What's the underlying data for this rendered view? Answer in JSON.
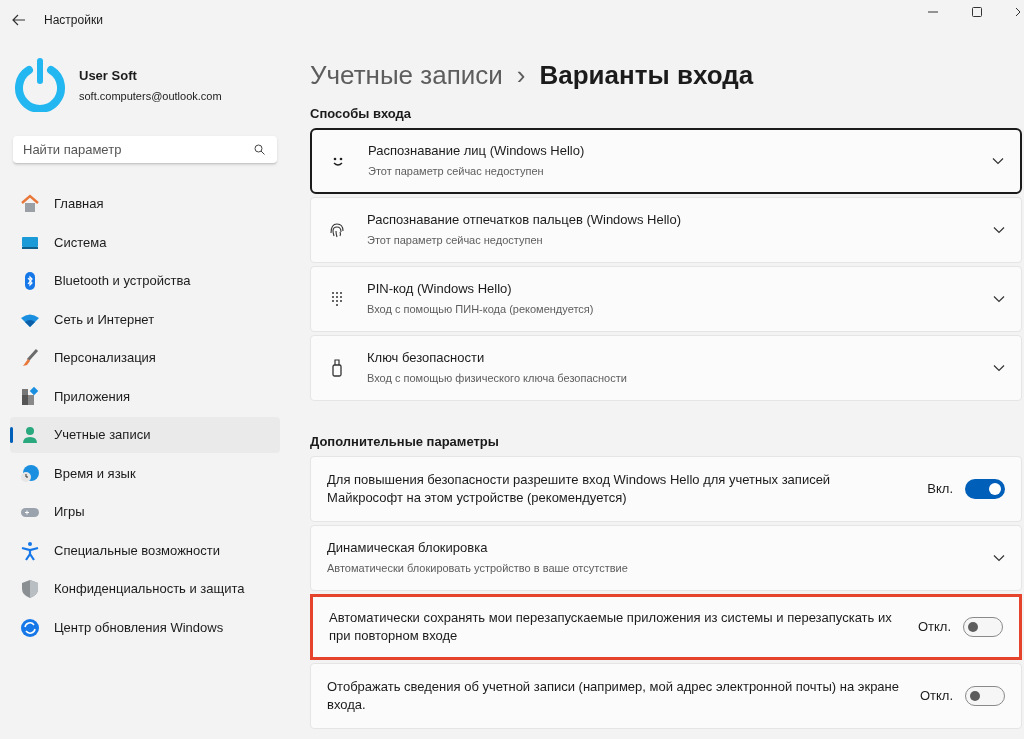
{
  "window": {
    "title": "Настройки"
  },
  "user": {
    "name": "User Soft",
    "email": "soft.computers@outlook.com"
  },
  "search": {
    "placeholder": "Найти параметр"
  },
  "sidebar": {
    "items": [
      {
        "label": "Главная",
        "selected": false
      },
      {
        "label": "Система",
        "selected": false
      },
      {
        "label": "Bluetooth и устройства",
        "selected": false
      },
      {
        "label": "Сеть и Интернет",
        "selected": false
      },
      {
        "label": "Персонализация",
        "selected": false
      },
      {
        "label": "Приложения",
        "selected": false
      },
      {
        "label": "Учетные записи",
        "selected": true
      },
      {
        "label": "Время и язык",
        "selected": false
      },
      {
        "label": "Игры",
        "selected": false
      },
      {
        "label": "Специальные возможности",
        "selected": false
      },
      {
        "label": "Конфиденциальность и защита",
        "selected": false
      },
      {
        "label": "Центр обновления Windows",
        "selected": false
      }
    ]
  },
  "breadcrumb": {
    "parent": "Учетные записи",
    "separator": "›",
    "current": "Варианты входа"
  },
  "sections": [
    {
      "heading": "Способы входа",
      "cards": [
        {
          "kind": "expander",
          "title": "Распознавание лиц (Windows Hello)",
          "subtitle": "Этот параметр сейчас недоступен",
          "focused": true,
          "highlighted": false
        },
        {
          "kind": "expander",
          "title": "Распознавание отпечатков пальцев (Windows Hello)",
          "subtitle": "Этот параметр сейчас недоступен",
          "focused": false,
          "highlighted": false
        },
        {
          "kind": "expander",
          "title": "PIN-код (Windows Hello)",
          "subtitle": "Вход с помощью ПИН-кода (рекомендуется)",
          "focused": false,
          "highlighted": false
        },
        {
          "kind": "expander",
          "title": "Ключ безопасности",
          "subtitle": "Вход с помощью физического ключа безопасности",
          "focused": false,
          "highlighted": false
        }
      ]
    },
    {
      "heading": "Дополнительные параметры",
      "cards": [
        {
          "kind": "toggle",
          "title": "Для повышения безопасности разрешите вход Windows Hello для учетных записей Майкрософт на этом устройстве (рекомендуется)",
          "state_label": "Вкл.",
          "on": true,
          "focused": false,
          "highlighted": false
        },
        {
          "kind": "expander",
          "title": "Динамическая блокировка",
          "subtitle": "Автоматически блокировать устройство в ваше отсутствие",
          "focused": false,
          "highlighted": false
        },
        {
          "kind": "toggle",
          "title": "Автоматически сохранять мои перезапускаемые приложения из системы и перезапускать их при повторном входе",
          "state_label": "Откл.",
          "on": false,
          "focused": false,
          "highlighted": true
        },
        {
          "kind": "toggle",
          "title": "Отображать сведения об учетной записи (например, мой адрес электронной почты) на экране входа.",
          "state_label": "Откл.",
          "on": false,
          "focused": false,
          "highlighted": false
        }
      ]
    }
  ]
}
